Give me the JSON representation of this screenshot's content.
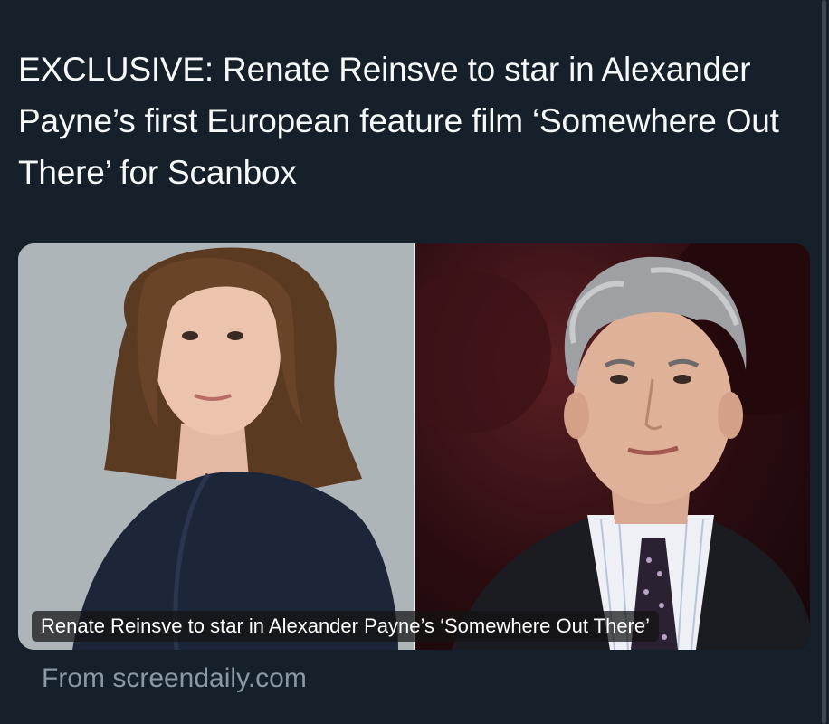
{
  "tweet": {
    "text": "EXCLUSIVE: Renate Reinsve to star in Alexander Payne’s first European feature film ‘Somewhere Out There’ for Scanbox"
  },
  "link_card": {
    "caption": "Renate Reinsve to star in Alexander Payne’s ‘Somewhere Out There’",
    "source": "From screendaily.com",
    "images": [
      {
        "subject": "woman-portrait"
      },
      {
        "subject": "man-portrait"
      }
    ]
  },
  "colors": {
    "background": "#15202b",
    "text": "#f7f9f9",
    "muted_text": "#8b98a5"
  }
}
